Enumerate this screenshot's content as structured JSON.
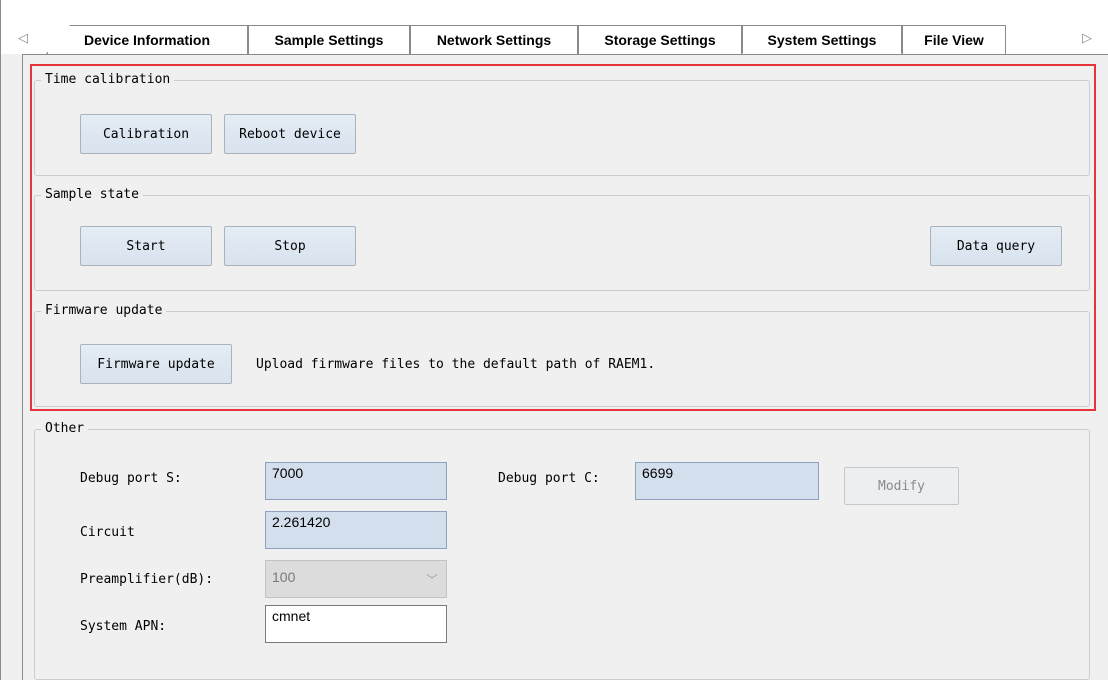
{
  "tabs": [
    {
      "label": "Device Information"
    },
    {
      "label": "Sample Settings"
    },
    {
      "label": "Network Settings"
    },
    {
      "label": "Storage Settings"
    },
    {
      "label": "System Settings"
    },
    {
      "label": "File View"
    }
  ],
  "active_tab": "System Settings",
  "time_calibration": {
    "legend": "Time calibration",
    "calibration_label": "Calibration",
    "reboot_label": "Reboot device"
  },
  "sample_state": {
    "legend": "Sample state",
    "start_label": "Start",
    "stop_label": "Stop",
    "data_query_label": "Data query"
  },
  "firmware_update": {
    "legend": "Firmware update",
    "button_label": "Firmware update",
    "hint": "Upload firmware files to the default path of RAEM1."
  },
  "other": {
    "legend": "Other",
    "debug_port_s_label": "Debug port S:",
    "debug_port_s_value": "7000",
    "debug_port_c_label": "Debug port C:",
    "debug_port_c_value": "6699",
    "modify_label": "Modify",
    "circuit_label": "Circuit",
    "circuit_value": "2.261420",
    "preamp_label": "Preamplifier(dB):",
    "preamp_value": "100",
    "apn_label": "System APN:",
    "apn_value": "cmnet"
  },
  "colors": {
    "highlight": "#e8333a",
    "field_bg": "#d3dfec",
    "button_bg": "#dde7f1"
  }
}
